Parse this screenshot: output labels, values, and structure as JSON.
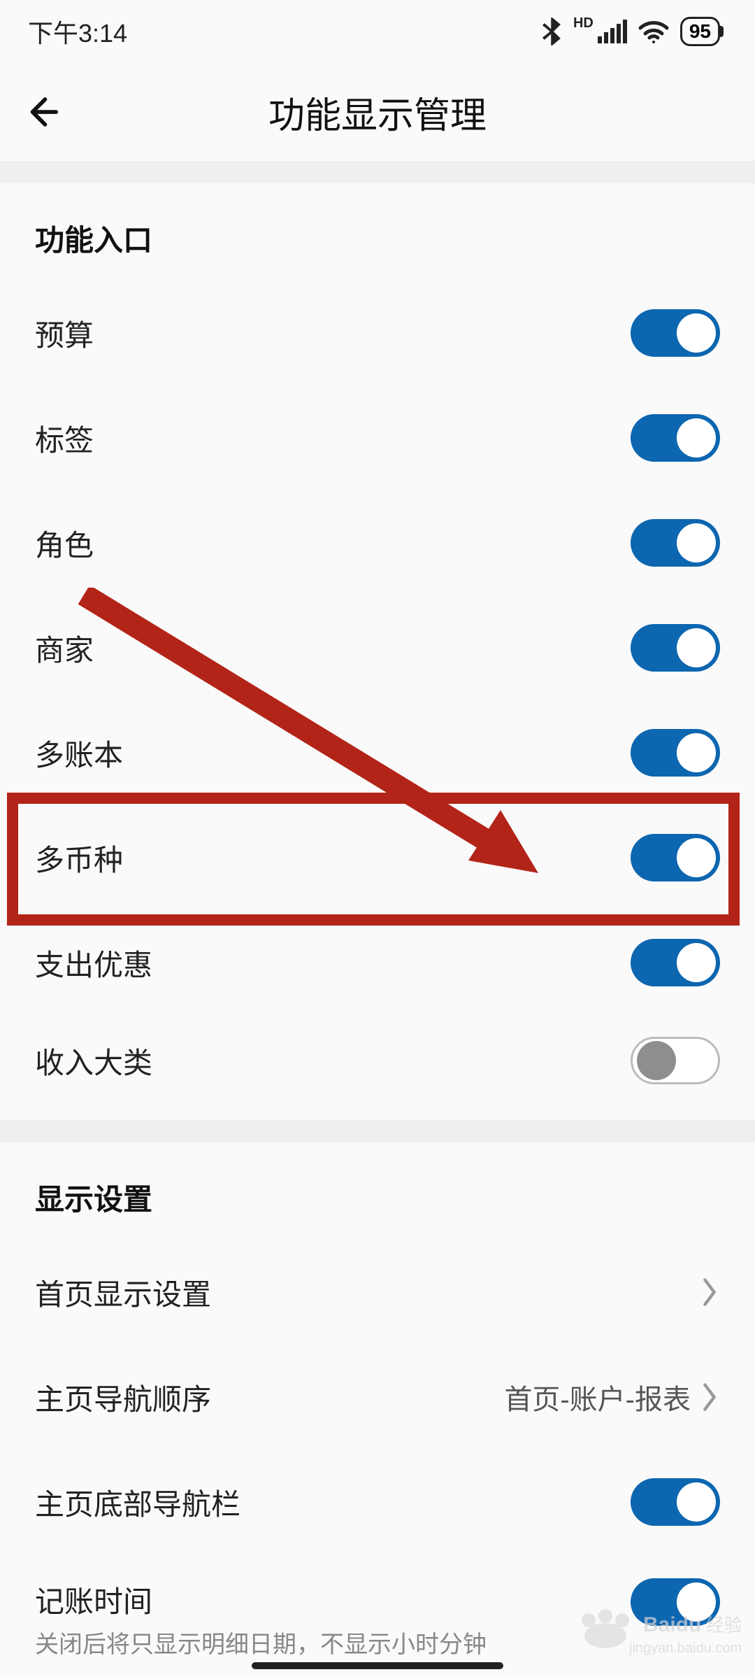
{
  "status": {
    "time": "下午3:14",
    "battery": "95"
  },
  "appbar": {
    "title": "功能显示管理"
  },
  "section_entry": {
    "header": "功能入口",
    "items": [
      {
        "label": "预算",
        "on": true
      },
      {
        "label": "标签",
        "on": true
      },
      {
        "label": "角色",
        "on": true
      },
      {
        "label": "商家",
        "on": true
      },
      {
        "label": "多账本",
        "on": true
      },
      {
        "label": "多币种",
        "on": true
      },
      {
        "label": "支出优惠",
        "on": true
      },
      {
        "label": "收入大类",
        "on": false
      }
    ]
  },
  "section_display": {
    "header": "显示设置",
    "items": [
      {
        "label": "首页显示设置",
        "type": "nav",
        "value": ""
      },
      {
        "label": "主页导航顺序",
        "type": "nav",
        "value": "首页-账户-报表"
      },
      {
        "label": "主页底部导航栏",
        "type": "toggle",
        "on": true
      },
      {
        "label": "记账时间",
        "type": "toggle",
        "on": true,
        "sub": "关闭后将只显示明细日期，不显示小时分钟"
      }
    ]
  },
  "annotation": {
    "highlight_item": "多币种"
  },
  "watermark": {
    "brand": "Baidu",
    "sub": "经验",
    "url": "jingyan.baidu.com"
  }
}
